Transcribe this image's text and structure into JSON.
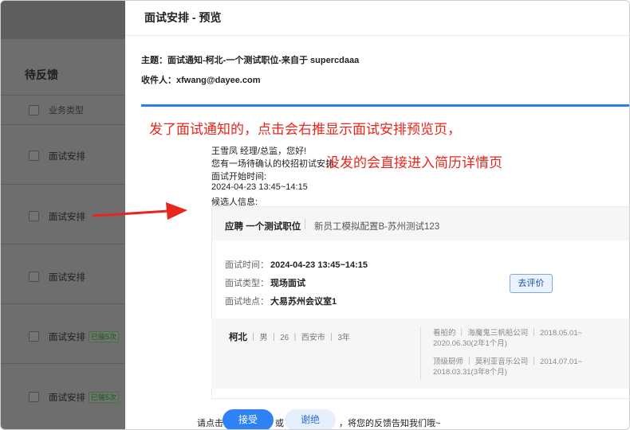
{
  "background": {
    "section_title": "待反馈",
    "column_header": "业务类型",
    "rows": [
      {
        "label": "面试安排",
        "badge": ""
      },
      {
        "label": "面试安排",
        "badge": ""
      },
      {
        "label": "面试安排",
        "badge": ""
      },
      {
        "label": "面试安排",
        "badge": "已催5次"
      },
      {
        "label": "面试安排",
        "badge": "已催5次"
      }
    ]
  },
  "drawer": {
    "title": "面试安排 - 预览",
    "subject_label": "主题：",
    "subject_value": "面试通知-柯北-一个测试职位-来自于 supercdaaa",
    "recipient_label": "收件人：",
    "recipient_value": "xfwang@dayee.com"
  },
  "annotation": {
    "line1": "发了面试通知的，点击会右推显示面试安排预览页，",
    "line2": "没发的会直接进入简历详情页",
    "color": "#e8261c"
  },
  "email": {
    "greeting": "王雪凤 经理/总监，您好!",
    "line2": "您有一场待确认的校招初试安排:",
    "start_label": "面试开始时间:",
    "start_value": "2024-04-23 13:45~14:15",
    "candidate_label": "候选人信息:",
    "card": {
      "role": "应聘 一个测试职位",
      "config": "新员工模拟配置B-苏州测试123",
      "time_label": "面试时间：",
      "time_value": "2024-04-23 13:45~14:15",
      "type_label": "面试类型：",
      "type_value": "现场面试",
      "place_label": "面试地点：",
      "place_value": "大易苏州会议室1",
      "evaluate_button": "去评价"
    },
    "candidate": {
      "name": "柯北",
      "details": "｜ 男 ｜ 26 ｜ 西安市 ｜ 3年",
      "experience": [
        {
          "line1": "看船的 ｜ 海魔鬼三帆船公司 ｜ 2018.05.01~",
          "line2": "2020.06.30(2年1个月)"
        },
        {
          "line1": "顶级厨师 ｜ 莫利亚音乐公司 ｜ 2014.07.01~",
          "line2": "2018.03.31(3年8个月)"
        }
      ]
    },
    "footer": {
      "prefix": "请点击",
      "accept": "接受",
      "or": "或",
      "decline": "谢绝",
      "suffix": "，将您的反馈告知我们哦~"
    }
  },
  "colors": {
    "accent": "#2e82f5",
    "top_border": "#2d7df0",
    "overlay": "#6e6e6e"
  }
}
